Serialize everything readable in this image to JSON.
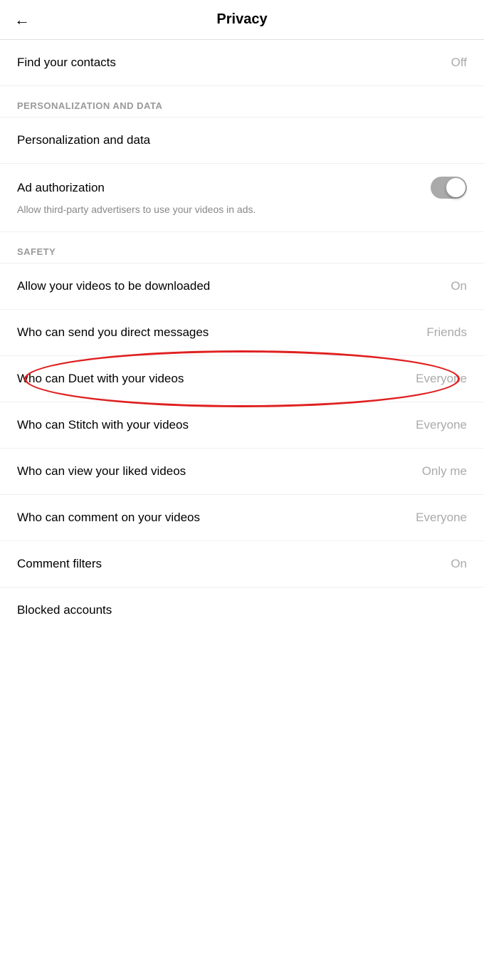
{
  "header": {
    "back_icon": "←",
    "title": "Privacy"
  },
  "sections": {
    "contacts": {
      "label": "Find your contacts",
      "value": "Off"
    },
    "personalization_header": "PERSONALIZATION AND DATA",
    "personalization": {
      "label": "Personalization and data"
    },
    "ad_authorization": {
      "label": "Ad authorization",
      "description": "Allow third-party advertisers to use your videos in ads."
    },
    "safety_header": "SAFETY",
    "safety_items": [
      {
        "id": "downloads",
        "label": "Allow your videos to be downloaded",
        "value": "On"
      },
      {
        "id": "direct_messages",
        "label": "Who can send you direct messages",
        "value": "Friends"
      },
      {
        "id": "duet",
        "label": "Who can Duet with your videos",
        "value": "Everyone",
        "highlighted": true
      },
      {
        "id": "stitch",
        "label": "Who can Stitch with your videos",
        "value": "Everyone"
      },
      {
        "id": "liked_videos",
        "label": "Who can view your liked videos",
        "value": "Only me"
      },
      {
        "id": "comment",
        "label": "Who can comment on your videos",
        "value": "Everyone"
      },
      {
        "id": "comment_filters",
        "label": "Comment filters",
        "value": "On"
      },
      {
        "id": "blocked_accounts",
        "label": "Blocked accounts",
        "value": ""
      }
    ]
  }
}
